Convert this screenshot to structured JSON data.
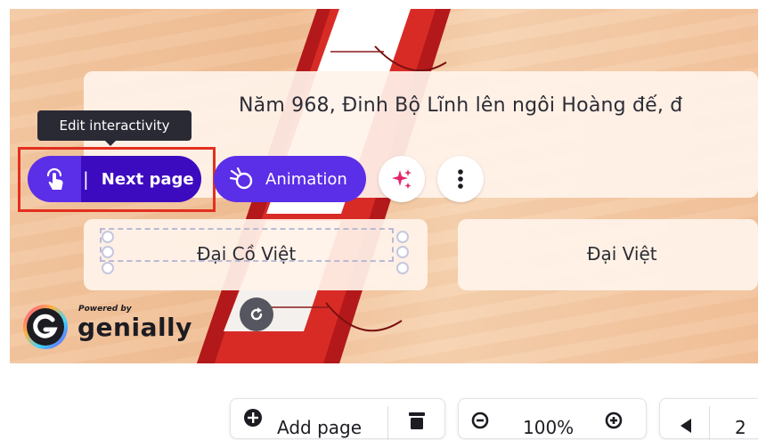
{
  "question": {
    "text": "Năm 968, Đinh Bộ Lĩnh lên ngôi Hoàng đế, đ"
  },
  "answers": [
    {
      "label": "Đại Cồ Việt"
    },
    {
      "label": "Đại Việt"
    }
  ],
  "tooltip": {
    "text": "Edit interactivity"
  },
  "toolbar_float": {
    "interactivity_label": "Next page",
    "separator": "|",
    "animation_label": "Animation",
    "sparkle_icon": "sparkle-icon",
    "more_icon": "more-vertical-icon"
  },
  "branding": {
    "powered": "Powered by",
    "name": "genially"
  },
  "bottom_toolbar": {
    "add_page_label": "Add page",
    "zoom": "100%",
    "page_number": "2"
  },
  "colors": {
    "accent_purple": "#5b2ee8",
    "accent_purple_dark": "#3d0bbf",
    "highlight_red": "#e3301f",
    "sparkle_pink": "#e2246b"
  }
}
